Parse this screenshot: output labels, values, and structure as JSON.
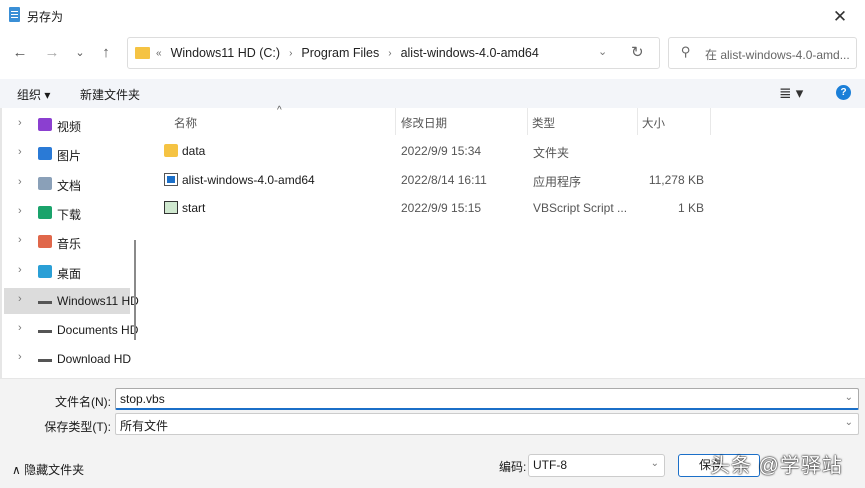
{
  "window": {
    "title": "另存为",
    "close": "✕"
  },
  "nav": {
    "back": "←",
    "forward": "→",
    "recent": "⌄",
    "up": "↑"
  },
  "address": {
    "prefix": "«",
    "crumbs": [
      "Windows11 HD (C:)",
      "Program Files",
      "alist-windows-4.0-amd64"
    ],
    "sep": "›",
    "dropdown": "⌄",
    "refresh": "↻"
  },
  "search": {
    "placeholder": "在 alist-windows-4.0-amd..."
  },
  "toolbar": {
    "organize": "组织 ▾",
    "new_folder": "新建文件夹",
    "view": "≣ ▾",
    "help": "?"
  },
  "sidebar": {
    "items": [
      {
        "label": "视频",
        "icon": "video-icon",
        "color": "#8b3fd0"
      },
      {
        "label": "图片",
        "icon": "pictures-icon",
        "color": "#2a7ad6"
      },
      {
        "label": "文档",
        "icon": "documents-icon",
        "color": "#8aa0b8"
      },
      {
        "label": "下载",
        "icon": "download-icon",
        "color": "#1aa36b"
      },
      {
        "label": "音乐",
        "icon": "music-icon",
        "color": "#e0674a"
      },
      {
        "label": "桌面",
        "icon": "desktop-icon",
        "color": "#2a9fd6"
      },
      {
        "label": "Windows11 HD (C:)",
        "icon": "drive-icon",
        "color": "#555555",
        "selected": true
      },
      {
        "label": "Documents HD",
        "icon": "drive-icon",
        "color": "#555555"
      },
      {
        "label": "Download HD",
        "icon": "drive-icon",
        "color": "#555555"
      }
    ]
  },
  "columns": {
    "name": "名称",
    "modified": "修改日期",
    "type": "类型",
    "size": "大小",
    "sort": "^"
  },
  "files": [
    {
      "name": "data",
      "modified": "2022/9/9 15:34",
      "type": "文件夹",
      "size": "",
      "icon": "folder-icon"
    },
    {
      "name": "alist-windows-4.0-amd64",
      "modified": "2022/8/14 16:11",
      "type": "应用程序",
      "size": "11,278 KB",
      "icon": "application-icon"
    },
    {
      "name": "start",
      "modified": "2022/9/9 15:15",
      "type": "VBScript Script ...",
      "size": "1 KB",
      "icon": "vbscript-icon"
    }
  ],
  "form": {
    "filename_label": "文件名(N):",
    "filename": "stop.vbs",
    "type_label": "保存类型(T):",
    "type": "所有文件",
    "encoding_label": "编码:",
    "encoding": "UTF-8",
    "save": "保存",
    "hide_folders": "∧  隐藏文件夹",
    "dropdown": "⌄"
  },
  "watermark": "头条 @学驿站"
}
